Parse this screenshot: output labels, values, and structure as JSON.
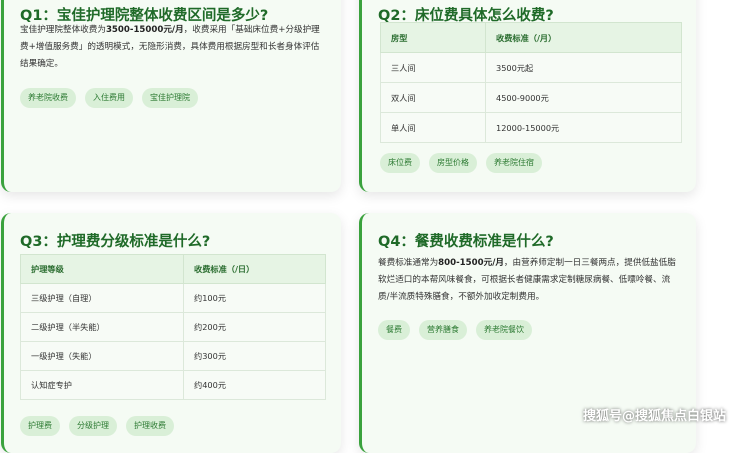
{
  "q1": {
    "title": "Q1：宝佳护理院整体收费区间是多少?",
    "text_pre": "宝佳护理院整体收费为",
    "text_bold": "3500-15000元/月",
    "text_post": "，收费采用「基础床位费+分级护理费+增值服务费」的透明模式，无隐形消费，具体费用根据房型和长者身体评估结果确定。",
    "tags": [
      "养老院收费",
      "入住费用",
      "宝佳护理院"
    ]
  },
  "q2": {
    "title": "Q2：床位费具体怎么收费?",
    "headers": [
      "房型",
      "收费标准（/月）"
    ],
    "rows": [
      [
        "三人间",
        "3500元起"
      ],
      [
        "双人间",
        "4500-9000元"
      ],
      [
        "单人间",
        "12000-15000元"
      ]
    ],
    "tags": [
      "床位费",
      "房型价格",
      "养老院住宿"
    ]
  },
  "q3": {
    "title": "Q3：护理费分级标准是什么?",
    "headers": [
      "护理等级",
      "收费标准（/日）"
    ],
    "rows": [
      [
        "三级护理（自理）",
        "约100元"
      ],
      [
        "二级护理（半失能）",
        "约200元"
      ],
      [
        "一级护理（失能）",
        "约300元"
      ],
      [
        "认知症专护",
        "约400元"
      ]
    ],
    "tags": [
      "护理费",
      "分级护理",
      "护理收费"
    ]
  },
  "q4": {
    "title": "Q4：餐费收费标准是什么?",
    "text_pre": "餐费标准通常为",
    "text_bold": "800-1500元/月",
    "text_post": "，由营养师定制一日三餐两点，提供低盐低脂软烂适口的本帮风味餐食，可根据长者健康需求定制糖尿病餐、低嘌呤餐、流质/半流质特殊膳食，不额外加收定制费用。",
    "tags": [
      "餐费",
      "营养膳食",
      "养老院餐饮"
    ]
  },
  "watermark": "搜狐号@搜狐焦点白银站"
}
